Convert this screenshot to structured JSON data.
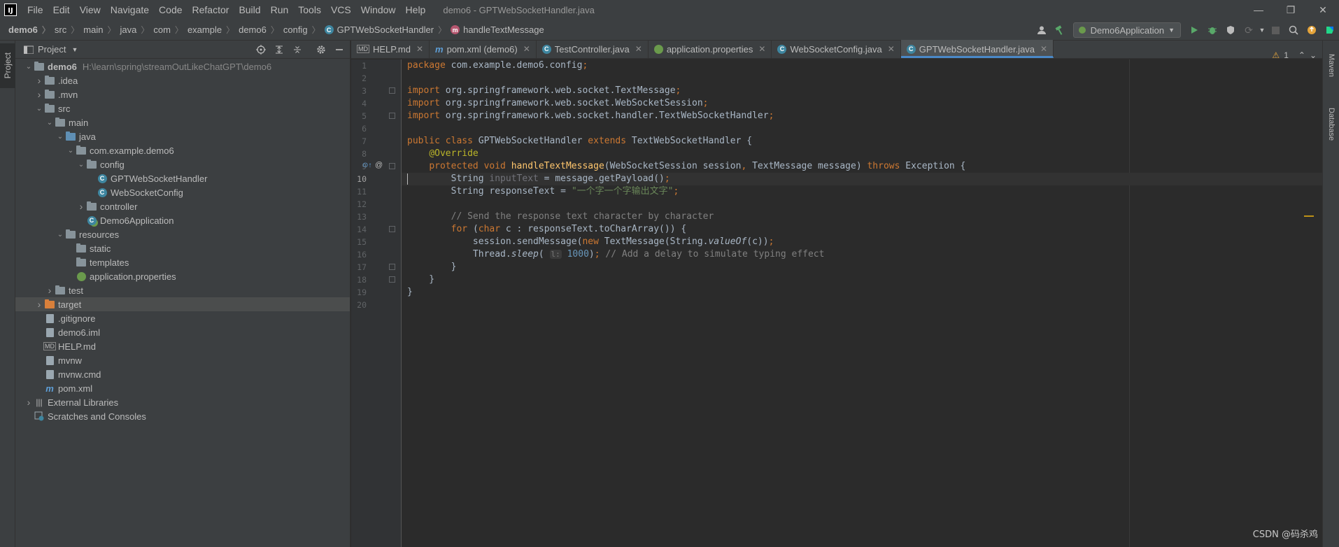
{
  "menubar": {
    "app_logo": "IJ",
    "items": [
      "File",
      "Edit",
      "View",
      "Navigate",
      "Code",
      "Refactor",
      "Build",
      "Run",
      "Tools",
      "VCS",
      "Window",
      "Help"
    ],
    "window_title": "demo6 - GPTWebSocketHandler.java",
    "controls": [
      "—",
      "❐",
      "✕"
    ]
  },
  "breadcrumbs": [
    "demo6",
    "src",
    "main",
    "java",
    "com",
    "example",
    "demo6",
    "config",
    "GPTWebSocketHandler",
    "handleTextMessage"
  ],
  "toolbar": {
    "run_config": "Demo6Application"
  },
  "left_strip": {
    "project_tab": "Project"
  },
  "project_panel": {
    "title": "Project",
    "tree": [
      {
        "label": "demo6",
        "path": "H:\\learn\\spring\\streamOutLikeChatGPT\\demo6",
        "depth": 0,
        "expanded": true,
        "icon": "folder"
      },
      {
        "label": ".idea",
        "depth": 1,
        "expanded": false,
        "icon": "folder"
      },
      {
        "label": ".mvn",
        "depth": 1,
        "expanded": false,
        "icon": "folder"
      },
      {
        "label": "src",
        "depth": 1,
        "expanded": true,
        "icon": "folder"
      },
      {
        "label": "main",
        "depth": 2,
        "expanded": true,
        "icon": "folder"
      },
      {
        "label": "java",
        "depth": 3,
        "expanded": true,
        "icon": "folder-blue"
      },
      {
        "label": "com.example.demo6",
        "depth": 4,
        "expanded": true,
        "icon": "package"
      },
      {
        "label": "config",
        "depth": 5,
        "expanded": true,
        "icon": "package"
      },
      {
        "label": "GPTWebSocketHandler",
        "depth": 6,
        "icon": "class"
      },
      {
        "label": "WebSocketConfig",
        "depth": 6,
        "icon": "class"
      },
      {
        "label": "controller",
        "depth": 5,
        "expanded": false,
        "icon": "package"
      },
      {
        "label": "Demo6Application",
        "depth": 5,
        "icon": "spring-class"
      },
      {
        "label": "resources",
        "depth": 3,
        "expanded": true,
        "icon": "folder-res"
      },
      {
        "label": "static",
        "depth": 4,
        "icon": "folder"
      },
      {
        "label": "templates",
        "depth": 4,
        "icon": "folder"
      },
      {
        "label": "application.properties",
        "depth": 4,
        "icon": "spring-leaf"
      },
      {
        "label": "test",
        "depth": 2,
        "expanded": false,
        "icon": "folder"
      },
      {
        "label": "target",
        "depth": 1,
        "expanded": false,
        "icon": "folder-orange",
        "selected": true
      },
      {
        "label": ".gitignore",
        "depth": 1,
        "icon": "file"
      },
      {
        "label": "demo6.iml",
        "depth": 1,
        "icon": "file"
      },
      {
        "label": "HELP.md",
        "depth": 1,
        "icon": "md"
      },
      {
        "label": "mvnw",
        "depth": 1,
        "icon": "file"
      },
      {
        "label": "mvnw.cmd",
        "depth": 1,
        "icon": "file"
      },
      {
        "label": "pom.xml",
        "depth": 1,
        "icon": "maven"
      },
      {
        "label": "External Libraries",
        "depth": 0,
        "expanded": false,
        "icon": "library"
      },
      {
        "label": "Scratches and Consoles",
        "depth": 0,
        "icon": "scratch"
      }
    ]
  },
  "editor": {
    "tabs": [
      {
        "label": "HELP.md",
        "icon": "md"
      },
      {
        "label": "pom.xml (demo6)",
        "icon": "maven"
      },
      {
        "label": "TestController.java",
        "icon": "class"
      },
      {
        "label": "application.properties",
        "icon": "spring-leaf"
      },
      {
        "label": "WebSocketConfig.java",
        "icon": "class"
      },
      {
        "label": "GPTWebSocketHandler.java",
        "icon": "class",
        "active": true
      }
    ],
    "inspection_count": "1",
    "current_line": 10,
    "line_numbers": [
      "1",
      "2",
      "3",
      "4",
      "5",
      "6",
      "7",
      "8",
      "9",
      "10",
      "11",
      "12",
      "13",
      "14",
      "15",
      "16",
      "17",
      "18",
      "19",
      "20"
    ]
  },
  "right_strip": {
    "tabs": [
      "Maven",
      "Database"
    ]
  },
  "watermark": "CSDN @码杀鸡"
}
